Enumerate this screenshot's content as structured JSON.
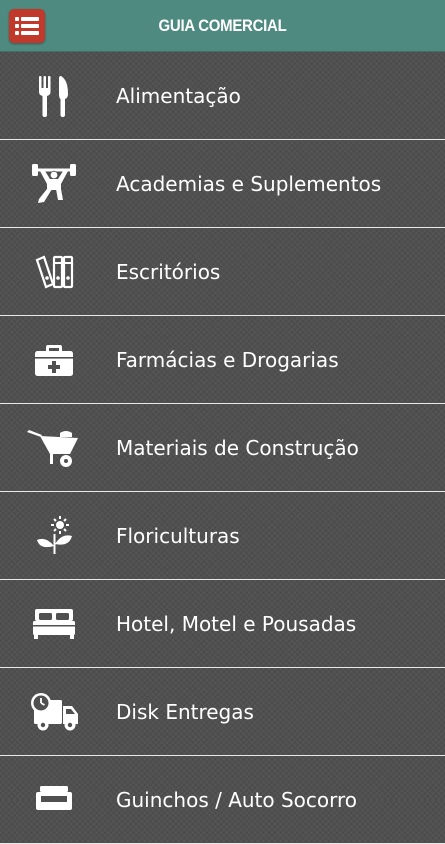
{
  "header": {
    "title": "GUIA COMERCIAL",
    "menu_icon": "list-icon",
    "accent_color": "#4e8a7f",
    "menu_button_color": "#c0392b"
  },
  "categories": [
    {
      "label": "Alimentação",
      "icon": "fork-knife-icon"
    },
    {
      "label": "Academias e Suplementos",
      "icon": "weightlifter-icon"
    },
    {
      "label": "Escritórios",
      "icon": "binders-icon"
    },
    {
      "label": "Farmácias e Drogarias",
      "icon": "first-aid-kit-icon"
    },
    {
      "label": "Materiais de Construção",
      "icon": "wheelbarrow-icon"
    },
    {
      "label": "Floriculturas",
      "icon": "flower-icon"
    },
    {
      "label": "Hotel, Motel e Pousadas",
      "icon": "bed-icon"
    },
    {
      "label": "Disk Entregas",
      "icon": "delivery-truck-icon"
    },
    {
      "label": "Guinchos / Auto Socorro",
      "icon": "tow-truck-icon"
    }
  ]
}
